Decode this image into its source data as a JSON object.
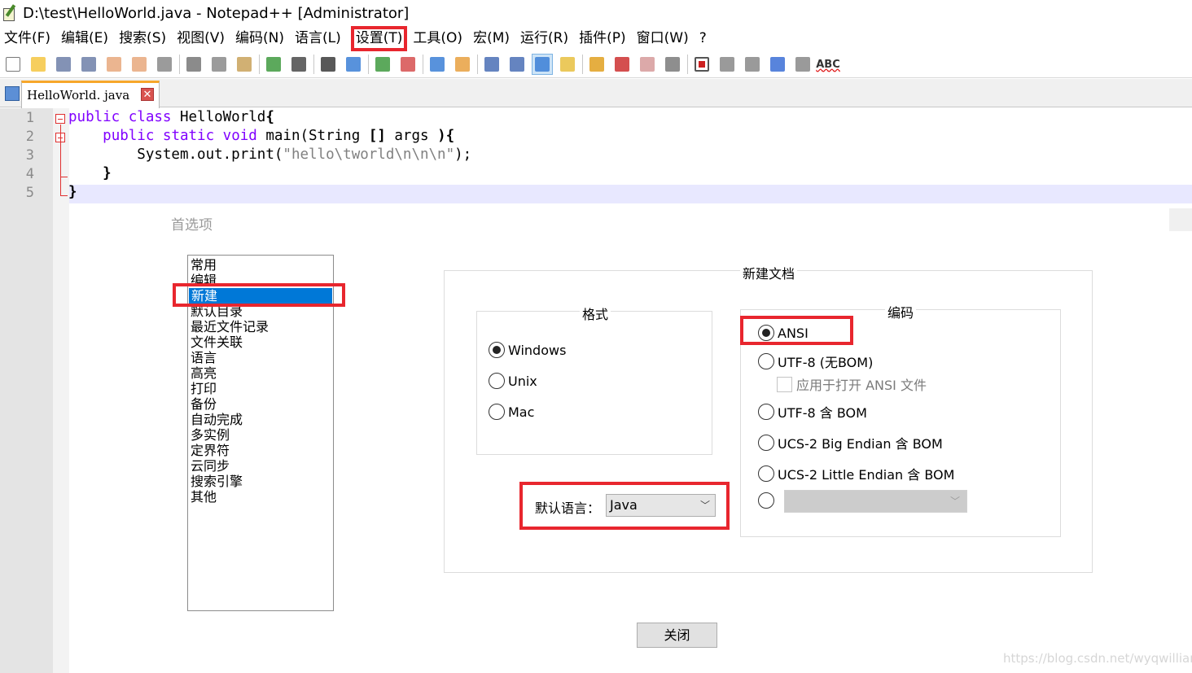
{
  "window": {
    "title": "D:\\test\\HelloWorld.java - Notepad++ [Administrator]"
  },
  "menu": [
    {
      "label": "文件(F)"
    },
    {
      "label": "编辑(E)"
    },
    {
      "label": "搜索(S)"
    },
    {
      "label": "视图(V)"
    },
    {
      "label": "编码(N)"
    },
    {
      "label": "语言(L)"
    },
    {
      "label": "设置(T)",
      "highlighted": true
    },
    {
      "label": "工具(O)"
    },
    {
      "label": "宏(M)"
    },
    {
      "label": "运行(R)"
    },
    {
      "label": "插件(P)"
    },
    {
      "label": "窗口(W)"
    },
    {
      "label": "?"
    }
  ],
  "toolbar": {
    "icons": [
      "new-file-icon",
      "open-file-icon",
      "save-icon",
      "save-all-icon",
      "close-icon",
      "close-all-icon",
      "print-icon",
      "cut-icon",
      "copy-icon",
      "paste-icon",
      "undo-icon",
      "redo-icon",
      "find-icon",
      "replace-icon",
      "zoom-in-icon",
      "zoom-out-icon",
      "sync-vertical-icon",
      "sync-horizontal-icon",
      "word-wrap-icon",
      "show-all-chars-icon",
      "indent-guide-icon",
      "user-language-icon",
      "doc-map-icon",
      "function-list-icon",
      "folder-workspace-icon",
      "monitor-icon",
      "record-macro-icon",
      "stop-macro-icon",
      "play-macro-icon",
      "run-macro-multiple-icon",
      "save-macro-icon"
    ],
    "spellcheck_label": "ABC"
  },
  "tab": {
    "label": "HelloWorld. java",
    "close_glyph": "✕"
  },
  "editor": {
    "lines": [
      {
        "num": "1",
        "parts": [
          [
            "kw",
            "public class "
          ],
          [
            "",
            "HelloWorld"
          ],
          [
            "br",
            "{"
          ]
        ]
      },
      {
        "num": "2",
        "parts": [
          [
            "",
            "    "
          ],
          [
            "kw",
            "public static void "
          ],
          [
            "",
            "main(String "
          ],
          [
            "br",
            "[]"
          ],
          [
            "",
            " args "
          ],
          [
            "br",
            "){"
          ]
        ]
      },
      {
        "num": "3",
        "parts": [
          [
            "",
            "        System.out.print("
          ],
          [
            "str",
            "\"hello\\tworld\\n\\n\\n\""
          ],
          [
            "",
            ");"
          ]
        ]
      },
      {
        "num": "4",
        "parts": [
          [
            "",
            "    "
          ],
          [
            "br",
            "}"
          ]
        ]
      },
      {
        "num": "5",
        "parts": [
          [
            "br",
            "}"
          ]
        ]
      }
    ]
  },
  "dialog": {
    "title": "首选项",
    "categories": [
      "常用",
      "编辑",
      "新建",
      "默认目录",
      "最近文件记录",
      "文件关联",
      "语言",
      "高亮",
      "打印",
      "备份",
      "自动完成",
      "多实例",
      "定界符",
      "云同步",
      "搜索引擎",
      "其他"
    ],
    "selected_category": "新建",
    "new_document_group": "新建文档",
    "format_group": "格式",
    "format_options": [
      {
        "label": "Windows",
        "checked": true
      },
      {
        "label": "Unix",
        "checked": false
      },
      {
        "label": "Mac",
        "checked": false
      }
    ],
    "encoding_group": "编码",
    "encoding_options": [
      {
        "label": "ANSI",
        "checked": true
      },
      {
        "label": "UTF-8 (无BOM)",
        "checked": false
      },
      {
        "label": "UTF-8 含 BOM",
        "checked": false
      },
      {
        "label": "UCS-2 Big Endian 含 BOM",
        "checked": false
      },
      {
        "label": "UCS-2 Little Endian 含 BOM",
        "checked": false
      }
    ],
    "apply_ansi_checkbox": "应用于打开 ANSI 文件",
    "default_language_label": "默认语言：",
    "default_language_value": "Java",
    "close_button": "关闭"
  },
  "watermark": "https://blog.csdn.net/wyqwilliam",
  "colors": {
    "highlight_red": "#e8262e",
    "selection_blue": "#0078d7",
    "keyword_purple": "#8000ff",
    "tab_accent": "#f7a72a"
  }
}
